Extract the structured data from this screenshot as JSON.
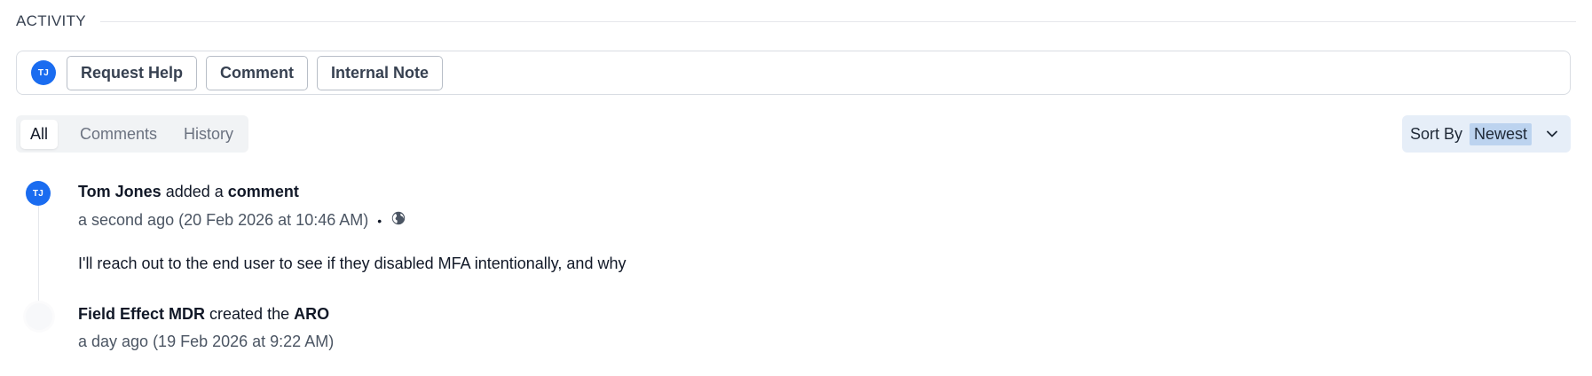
{
  "section": {
    "title": "ACTIVITY"
  },
  "composer": {
    "avatar_initials": "TJ",
    "buttons": [
      "Request Help",
      "Comment",
      "Internal Note"
    ]
  },
  "filter": {
    "tabs": [
      "All",
      "Comments",
      "History"
    ],
    "active": "All"
  },
  "sort": {
    "label": "Sort By",
    "value": "Newest"
  },
  "entries": [
    {
      "avatar_initials": "TJ",
      "actor": "Tom Jones",
      "action": "added a",
      "object": "comment",
      "time": "a second ago (20 Feb 2026 at 10:46 AM)",
      "separator": "•",
      "visibility_icon": "globe-icon",
      "body": "I'll reach out to the end user to see if they disabled MFA intentionally, and why"
    },
    {
      "actor": "Field Effect MDR",
      "action": "created the",
      "object": "ARO",
      "time": "a day ago (19 Feb 2026 at 9:22 AM)"
    }
  ],
  "colors": {
    "accent": "#1a6cf0",
    "sort_bg": "#e6eef8",
    "sort_value_bg": "#bcd3ef"
  }
}
